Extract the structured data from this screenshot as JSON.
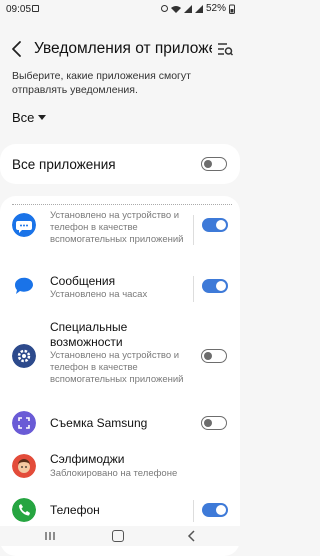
{
  "status_bar": {
    "time": "09:05",
    "battery": "52%"
  },
  "header": {
    "title": "Уведомления от приложений",
    "back_icon": "back-arrow-icon",
    "search_icon": "list-search-icon"
  },
  "description": "Выберите, какие приложения смогут отправлять уведомления.",
  "filter": {
    "selected": "Все"
  },
  "all_apps": {
    "label": "Все приложения",
    "enabled": false
  },
  "apps": [
    {
      "name": "",
      "sub": "Установлено на устройство и телефон в качестве вспомогательных приложений",
      "icon": "message-bubble-icon",
      "color": "#1a73e8",
      "enabled": true
    },
    {
      "name": "Сообщения",
      "sub": "Установлено на часах",
      "icon": "messages-icon",
      "color": "#1a73e8",
      "enabled": true
    },
    {
      "name": "Специальные возможности",
      "sub": "Установлено на устройство и телефон в качестве вспомогательных приложений",
      "icon": "accessibility-gear-icon",
      "color": "#2d4a8c",
      "enabled": false
    },
    {
      "name": "Съемка Samsung",
      "sub": "",
      "icon": "screen-capture-icon",
      "color": "#6a5bd6",
      "enabled": false
    },
    {
      "name": "Сэлфимоджи",
      "sub": "Заблокировано на телефоне",
      "icon": "selfiemoji-icon",
      "color": "#e34c3a",
      "enabled": false
    },
    {
      "name": "Телефон",
      "sub": "",
      "icon": "phone-icon",
      "color": "#26a541",
      "enabled": true
    }
  ]
}
